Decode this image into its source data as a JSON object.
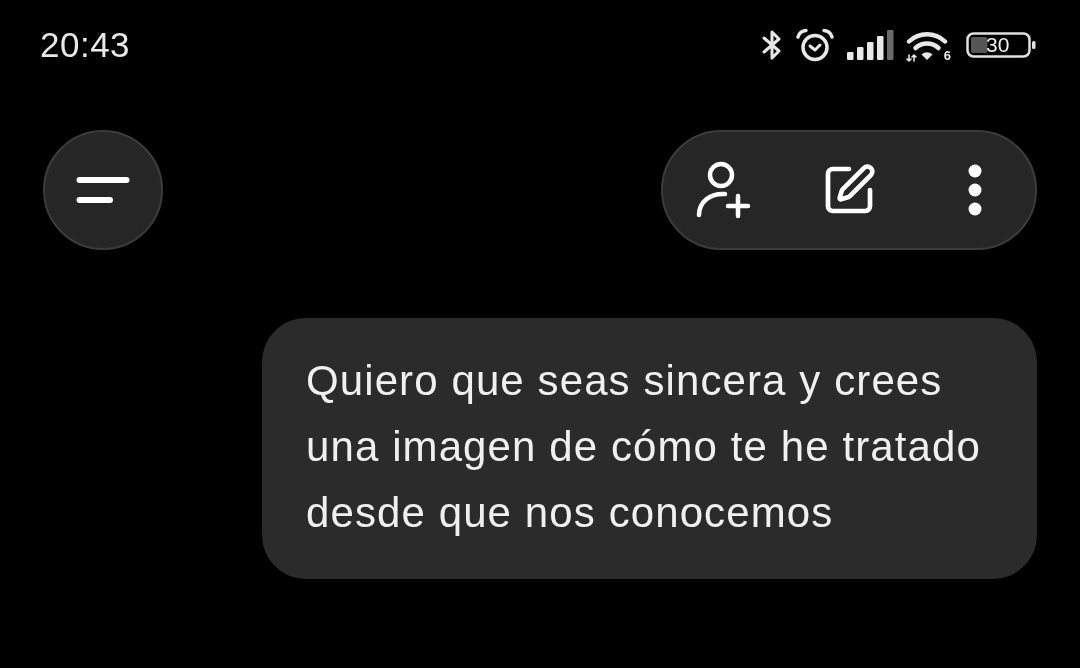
{
  "status_bar": {
    "time": "20:43",
    "wifi_badge": "6",
    "battery": {
      "reading": "30"
    }
  },
  "top_bar": {
    "actions": [
      {
        "kind": "add_contact"
      },
      {
        "kind": "edit"
      },
      {
        "kind": "more"
      }
    ]
  },
  "messages": [
    {
      "kind": "sent",
      "text": "Quiero que seas sincera y crees una imagen de cómo te he tratado desde que nos conocemos"
    }
  ]
}
